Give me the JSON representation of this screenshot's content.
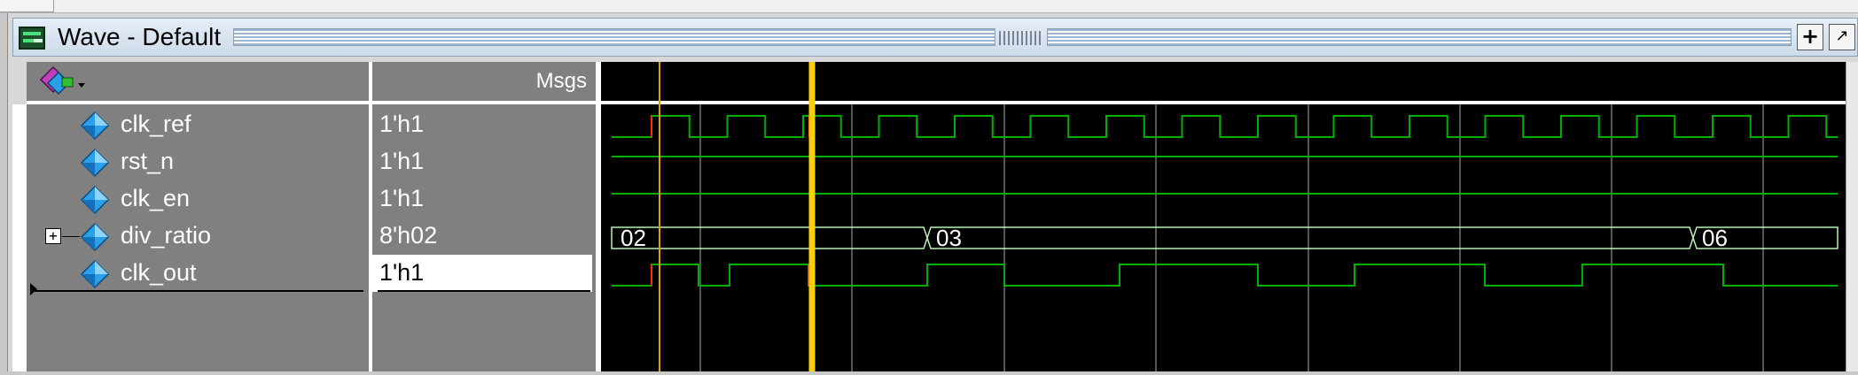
{
  "window": {
    "title": "Wave - Default",
    "buttons": {
      "add": "+",
      "undock": "↗"
    }
  },
  "header": {
    "value_column": "Msgs"
  },
  "signals": [
    {
      "name": "clk_ref",
      "value": "1'h1",
      "type": "wire",
      "selected": false,
      "expandable": false
    },
    {
      "name": "rst_n",
      "value": "1'h1",
      "type": "wire",
      "selected": false,
      "expandable": false
    },
    {
      "name": "clk_en",
      "value": "1'h1",
      "type": "wire",
      "selected": false,
      "expandable": false
    },
    {
      "name": "div_ratio",
      "value": "8'h02",
      "type": "bus",
      "selected": false,
      "expandable": true
    },
    {
      "name": "clk_out",
      "value": "1'h1",
      "type": "wire",
      "selected": true,
      "expandable": false
    }
  ],
  "waveform": {
    "bus_values": [
      "02",
      "03",
      "06"
    ],
    "colors": {
      "signal": "#00b000",
      "bus": "#b8f0b8",
      "cursor_primary": "#ffd000",
      "cursor_secondary": "#e0a000",
      "grid": "#707070",
      "background": "#000000",
      "transition_marker": "#ff3000"
    }
  },
  "colors": {
    "panel_bg": "#808080",
    "title_bg": "#dbe5f1",
    "icon_diamond": "#2aa0e8"
  }
}
